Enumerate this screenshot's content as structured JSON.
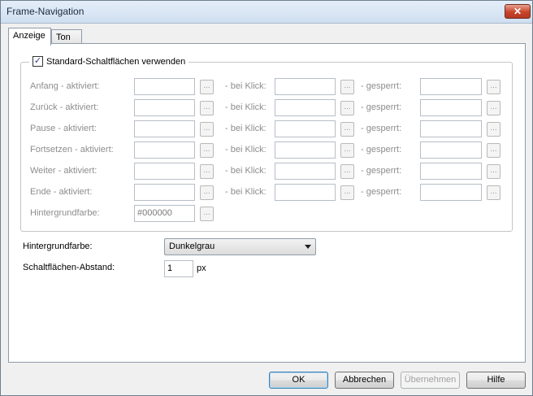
{
  "window": {
    "title": "Frame-Navigation",
    "close_glyph": "✕"
  },
  "tabs": [
    {
      "label": "Anzeige",
      "active": true
    },
    {
      "label": "Ton",
      "active": false
    }
  ],
  "group": {
    "checkbox_label": "Standard-Schaltflächen verwenden",
    "checked": true,
    "checkmark": "✓",
    "rows": [
      {
        "label": "Anfang - aktiviert:",
        "click_label": "- bei Klick:",
        "locked_label": "- gesperrt:"
      },
      {
        "label": "Zurück - aktiviert:",
        "click_label": "- bei Klick:",
        "locked_label": "- gesperrt:"
      },
      {
        "label": "Pause - aktiviert:",
        "click_label": "- bei Klick:",
        "locked_label": "- gesperrt:"
      },
      {
        "label": "Fortsetzen - aktiviert:",
        "click_label": "- bei Klick:",
        "locked_label": "- gesperrt:"
      },
      {
        "label": "Weiter - aktiviert:",
        "click_label": "- bei Klick:",
        "locked_label": "- gesperrt:"
      },
      {
        "label": "Ende - aktiviert:",
        "click_label": "- bei Klick:",
        "locked_label": "- gesperrt:"
      }
    ],
    "background": {
      "label": "Hintergrundfarbe:",
      "value": "#000000"
    },
    "browse_glyph": "..."
  },
  "settings": {
    "background_label": "Hintergrundfarbe:",
    "background_value": "Dunkelgrau",
    "spacing_label": "Schaltflächen-Abstand:",
    "spacing_value": "1",
    "spacing_unit": "px"
  },
  "buttons": {
    "ok": "OK",
    "cancel": "Abbrechen",
    "apply": "Übernehmen",
    "help": "Hilfe"
  },
  "colors": {
    "disabled_text": "#8d8d8d",
    "close_red": "#c8432a"
  }
}
